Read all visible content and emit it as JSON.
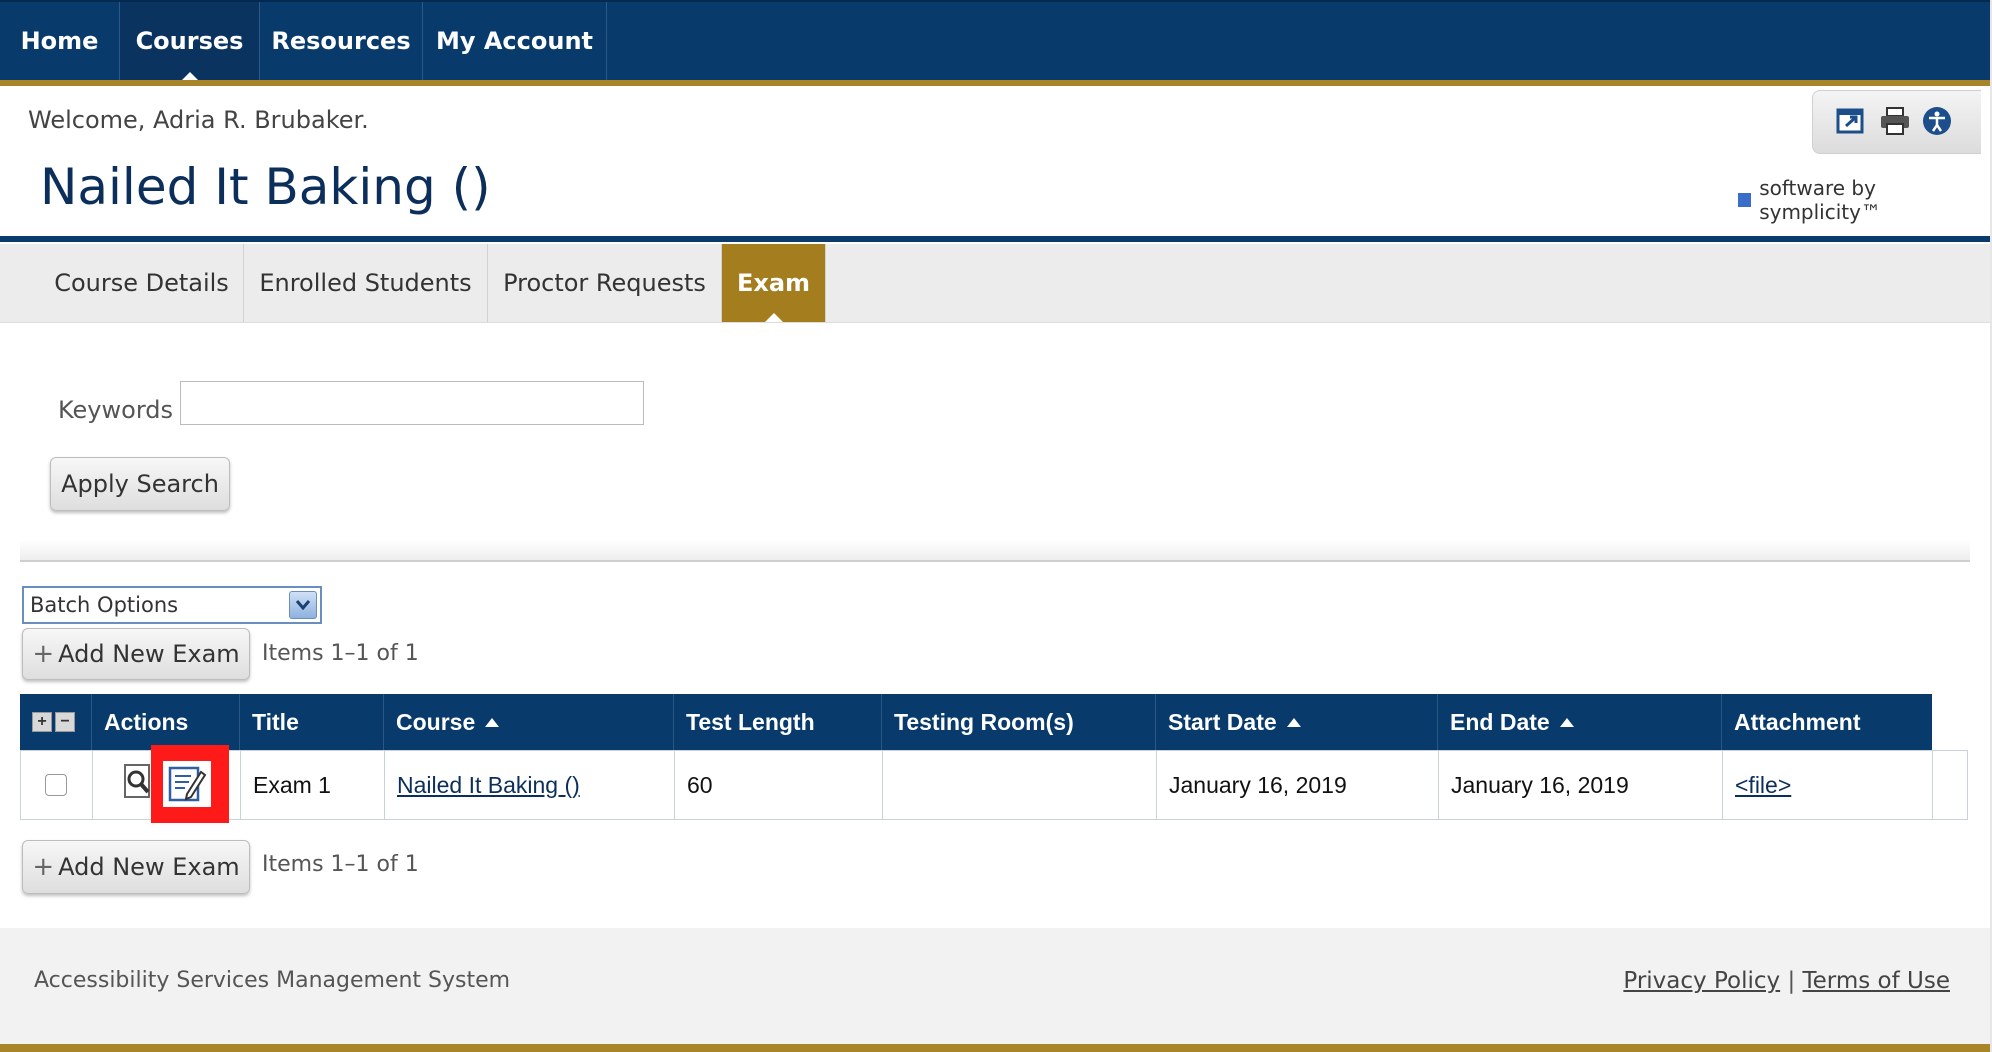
{
  "topnav": {
    "items": [
      {
        "label": "Home"
      },
      {
        "label": "Courses"
      },
      {
        "label": "Resources"
      },
      {
        "label": "My Account"
      }
    ],
    "active": "Courses"
  },
  "header": {
    "welcome": "Welcome, Adria R. Brubaker.",
    "title": "Nailed It Baking ()",
    "brand": "software by symplicity™",
    "utility_icons": [
      "popout-icon",
      "print-icon",
      "accessibility-icon"
    ]
  },
  "subtabs": {
    "items": [
      {
        "label": "Course Details"
      },
      {
        "label": "Enrolled Students"
      },
      {
        "label": "Proctor Requests"
      },
      {
        "label": "Exam"
      }
    ],
    "active": "Exam"
  },
  "search": {
    "keywords_label": "Keywords",
    "keywords_value": "",
    "apply_label": "Apply Search"
  },
  "list": {
    "batch_options": "Batch Options",
    "add_label": "Add New Exam",
    "items_count": "Items 1–1 of 1",
    "columns": {
      "actions": "Actions",
      "title": "Title",
      "course": "Course",
      "test_length": "Test Length",
      "testing_rooms": "Testing Room(s)",
      "start_date": "Start Date",
      "end_date": "End Date",
      "attachment": "Attachment"
    },
    "rows": [
      {
        "title": "Exam 1",
        "course": "Nailed It Baking ()",
        "test_length": "60",
        "testing_rooms": "",
        "start_date": "January 16, 2019",
        "end_date": "January 16, 2019",
        "attachment": "<file>"
      }
    ]
  },
  "footer": {
    "system_name": "Accessibility Services Management System",
    "privacy": "Privacy Policy",
    "separator": "|",
    "terms": "Terms of Use"
  },
  "colors": {
    "nav_blue": "#083a6c",
    "gold": "#a47d1f",
    "highlight_red": "#ff1a1a"
  }
}
